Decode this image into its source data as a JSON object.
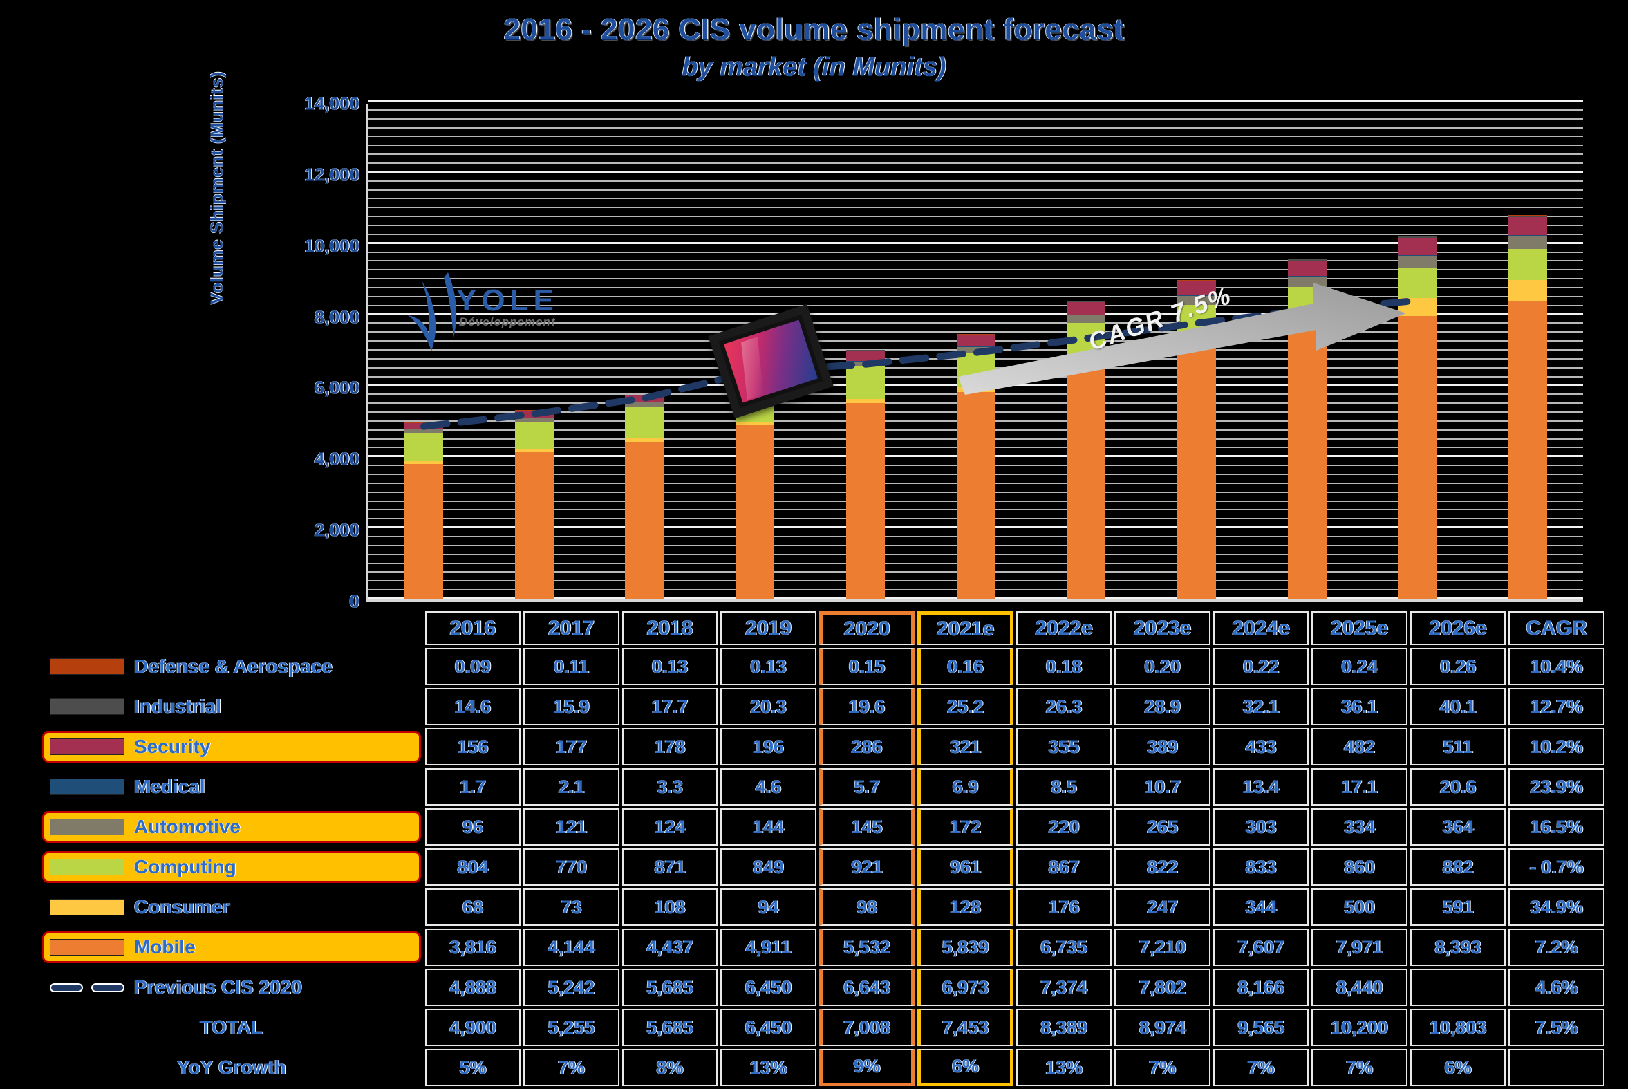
{
  "header": {
    "title": "2016 - 2026 CIS volume shipment forecast",
    "subtitle": "by market (in Munits)"
  },
  "logo": {
    "name": "YOLE",
    "tagline": "Développement"
  },
  "annotation": {
    "cagr_arrow_label": "CAGR 7.5%"
  },
  "chart_data": {
    "type": "bar",
    "title": "2016 - 2026 CIS volume shipment forecast by market (in Munits)",
    "xlabel": "",
    "ylabel": "Volume Shipment (Munits)",
    "ylim": [
      0,
      14000
    ],
    "yticks": [
      "0",
      "2,000",
      "4,000",
      "6,000",
      "8,000",
      "10,000",
      "12,000",
      "14,000"
    ],
    "grid": true,
    "stacked": true,
    "legend_position": "table-left",
    "categories": [
      "2016",
      "2017",
      "2018",
      "2019",
      "2020",
      "2021e",
      "2022e",
      "2023e",
      "2024e",
      "2025e",
      "2026e"
    ],
    "series": [
      {
        "name": "Mobile",
        "color": "#ED7D31",
        "values": [
          3816,
          4144,
          4437,
          4911,
          5532,
          5839,
          6735,
          7210,
          7607,
          7971,
          8393
        ]
      },
      {
        "name": "Consumer",
        "color": "#FFC843",
        "values": [
          68,
          73,
          108,
          94,
          98,
          128,
          176,
          247,
          344,
          500,
          591
        ]
      },
      {
        "name": "Computing",
        "color": "#BBD645",
        "values": [
          804,
          770,
          871,
          849,
          921,
          961,
          867,
          822,
          833,
          860,
          882
        ]
      },
      {
        "name": "Automotive",
        "color": "#7F7B68",
        "values": [
          96,
          121,
          124,
          144,
          145,
          172,
          220,
          265,
          303,
          334,
          364
        ]
      },
      {
        "name": "Medical",
        "color": "#1F4E79",
        "values": [
          1.7,
          2.1,
          3.3,
          4.6,
          5.7,
          6.9,
          8.5,
          10.7,
          13.4,
          17.1,
          20.6
        ]
      },
      {
        "name": "Security",
        "color": "#A33050",
        "values": [
          156,
          177,
          178,
          196,
          286,
          321,
          355,
          389,
          433,
          482,
          511
        ]
      },
      {
        "name": "Industrial",
        "color": "#4D4D4D",
        "values": [
          14.6,
          15.9,
          17.7,
          20.3,
          19.6,
          25.2,
          26.3,
          28.9,
          32.1,
          36.1,
          40.1
        ]
      },
      {
        "name": "Defense & Aerospace",
        "color": "#B5400E",
        "values": [
          0.09,
          0.11,
          0.13,
          0.13,
          0.15,
          0.16,
          0.18,
          0.2,
          0.22,
          0.24,
          0.26
        ]
      }
    ],
    "line_series": {
      "name": "Previous CIS 2020",
      "color": "#1F3864",
      "style": "dashed",
      "values": [
        4888,
        5242,
        5685,
        6450,
        6643,
        6973,
        7374,
        7802,
        8166,
        8440,
        null
      ]
    },
    "totals": [
      4900,
      5255,
      5685,
      6450,
      7008,
      7453,
      8389,
      8974,
      9565,
      10200,
      10803
    ]
  },
  "table": {
    "columns": [
      "2016",
      "2017",
      "2018",
      "2019",
      "2020",
      "2021e",
      "2022e",
      "2023e",
      "2024e",
      "2025e",
      "2026e",
      "CAGR"
    ],
    "highlight_columns": {
      "orange": "2020",
      "yellow": "2021e"
    },
    "rows": [
      {
        "label": "Defense & Aerospace",
        "swatch": "#B5400E",
        "highlight": false,
        "type": "swatch",
        "values": [
          "0.09",
          "0.11",
          "0.13",
          "0.13",
          "0.15",
          "0.16",
          "0.18",
          "0.20",
          "0.22",
          "0.24",
          "0.26",
          "10.4%"
        ]
      },
      {
        "label": "Industrial",
        "swatch": "#4D4D4D",
        "highlight": false,
        "type": "swatch",
        "values": [
          "14.6",
          "15.9",
          "17.7",
          "20.3",
          "19.6",
          "25.2",
          "26.3",
          "28.9",
          "32.1",
          "36.1",
          "40.1",
          "12.7%"
        ]
      },
      {
        "label": "Security",
        "swatch": "#A33050",
        "highlight": true,
        "type": "swatch",
        "values": [
          "156",
          "177",
          "178",
          "196",
          "286",
          "321",
          "355",
          "389",
          "433",
          "482",
          "511",
          "10.2%"
        ]
      },
      {
        "label": "Medical",
        "swatch": "#1F4E79",
        "highlight": false,
        "type": "swatch",
        "values": [
          "1.7",
          "2.1",
          "3.3",
          "4.6",
          "5.7",
          "6.9",
          "8.5",
          "10.7",
          "13.4",
          "17.1",
          "20.6",
          "23.9%"
        ]
      },
      {
        "label": "Automotive",
        "swatch": "#7F7B68",
        "highlight": true,
        "type": "swatch",
        "values": [
          "96",
          "121",
          "124",
          "144",
          "145",
          "172",
          "220",
          "265",
          "303",
          "334",
          "364",
          "16.5%"
        ]
      },
      {
        "label": "Computing",
        "swatch": "#BBD645",
        "highlight": true,
        "type": "swatch",
        "values": [
          "804",
          "770",
          "871",
          "849",
          "921",
          "961",
          "867",
          "822",
          "833",
          "860",
          "882",
          "- 0.7%"
        ]
      },
      {
        "label": "Consumer",
        "swatch": "#FFC843",
        "highlight": false,
        "type": "swatch",
        "values": [
          "68",
          "73",
          "108",
          "94",
          "98",
          "128",
          "176",
          "247",
          "344",
          "500",
          "591",
          "34.9%"
        ]
      },
      {
        "label": "Mobile",
        "swatch": "#ED7D31",
        "highlight": true,
        "type": "swatch",
        "values": [
          "3,816",
          "4,144",
          "4,437",
          "4,911",
          "5,532",
          "5,839",
          "6,735",
          "7,210",
          "7,607",
          "7,971",
          "8,393",
          "7.2%"
        ]
      },
      {
        "label": "Previous CIS 2020",
        "swatch": "#1F3864",
        "highlight": false,
        "type": "dashline",
        "values": [
          "4,888",
          "5,242",
          "5,685",
          "6,450",
          "6,643",
          "6,973",
          "7,374",
          "7,802",
          "8,166",
          "8,440",
          "",
          "4.6%"
        ]
      },
      {
        "label": "TOTAL",
        "swatch": "",
        "highlight": false,
        "type": "text",
        "values": [
          "4,900",
          "5,255",
          "5,685",
          "6,450",
          "7,008",
          "7,453",
          "8,389",
          "8,974",
          "9,565",
          "10,200",
          "10,803",
          "7.5%"
        ]
      },
      {
        "label": "YoY Growth",
        "swatch": "",
        "highlight": false,
        "type": "text",
        "values": [
          "5%",
          "7%",
          "8%",
          "13%",
          "9%",
          "6%",
          "13%",
          "7%",
          "7%",
          "7%",
          "6%",
          ""
        ]
      }
    ]
  }
}
